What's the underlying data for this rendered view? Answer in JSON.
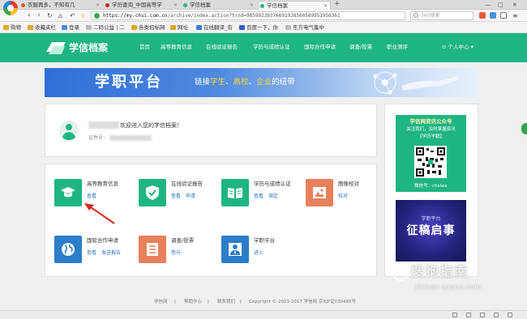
{
  "browser": {
    "tabs": [
      {
        "title": "衣服再多，不知有几",
        "close": "✕"
      },
      {
        "title": "学历查询_中国高等学",
        "close": "✕"
      },
      {
        "title": "学信档案",
        "close": "✕"
      },
      {
        "title": "学信档案",
        "close": "✕"
      }
    ],
    "new_tab": "+",
    "window_controls": [
      "—",
      "□",
      "✕"
    ],
    "url_host": "https://my.chsi.com.cn",
    "url_path": "/archive/index.action?trnd=98599239376692928560589951956361",
    "search_placeholder": "360搜索",
    "bookmarks": [
      "购物",
      "收藏夹栏",
      "登录",
      "二码公益 | 二",
      "各类招标网",
      "网址",
      "在线翻译_有",
      "百度一下，你",
      "东方电气集中"
    ]
  },
  "site": {
    "logo": "学信档案",
    "nav": [
      "首页",
      "高等教育信息",
      "在线验证报告",
      "学历与成绩认证",
      "国际合作申请",
      "调查/投票",
      "职业测评"
    ],
    "user_menu": "个人中心 ▾"
  },
  "banner": {
    "title": "学职平台",
    "slogan_pre": "链接",
    "slogan_hl1": "学生",
    "slogan_sep1": "、",
    "slogan_hl2": "高校",
    "slogan_sep2": "、",
    "slogan_hl3": "企业",
    "slogan_post": "的纽带"
  },
  "profile": {
    "welcome": "欢迎进入您的学信档案！",
    "id_label": "证件号："
  },
  "services": [
    {
      "title": "高等教育信息",
      "links": [
        "查看"
      ]
    },
    {
      "title": "在线验证报告",
      "links": [
        "查看",
        "申请"
      ]
    },
    {
      "title": "学历与成绩认证",
      "links": [
        "查看",
        "调定"
      ]
    },
    {
      "title": "图像校对",
      "links": [
        "校对"
      ]
    },
    {
      "title": "国际合作申请",
      "links": [
        "查看",
        "发送报告"
      ]
    },
    {
      "title": "调查/投票",
      "links": [
        "参与"
      ]
    },
    {
      "title": "学职平台",
      "links": [
        "进入"
      ]
    }
  ],
  "qr": {
    "title": "学信网资讯公众号",
    "desc1": "关注我们，及时掌握资讯",
    "desc2": "【学历学籍】",
    "wechat": "微信号：chsiwx"
  },
  "promo": {
    "sub": "学职平台",
    "main": "征稿启事"
  },
  "footer": {
    "links": [
      "学信网",
      "帮助中心",
      "联系我们"
    ],
    "separator": "|",
    "copyright": "Copyright © 2003-2017 学信网 京ICP证030485号"
  },
  "watermark": {
    "main": "搜狗指南",
    "sub": "zhinan.sogou.com"
  },
  "colors": {
    "brand_green": "#1fb483",
    "link_blue": "#2a73c4",
    "arrow_red": "#d9291c"
  }
}
